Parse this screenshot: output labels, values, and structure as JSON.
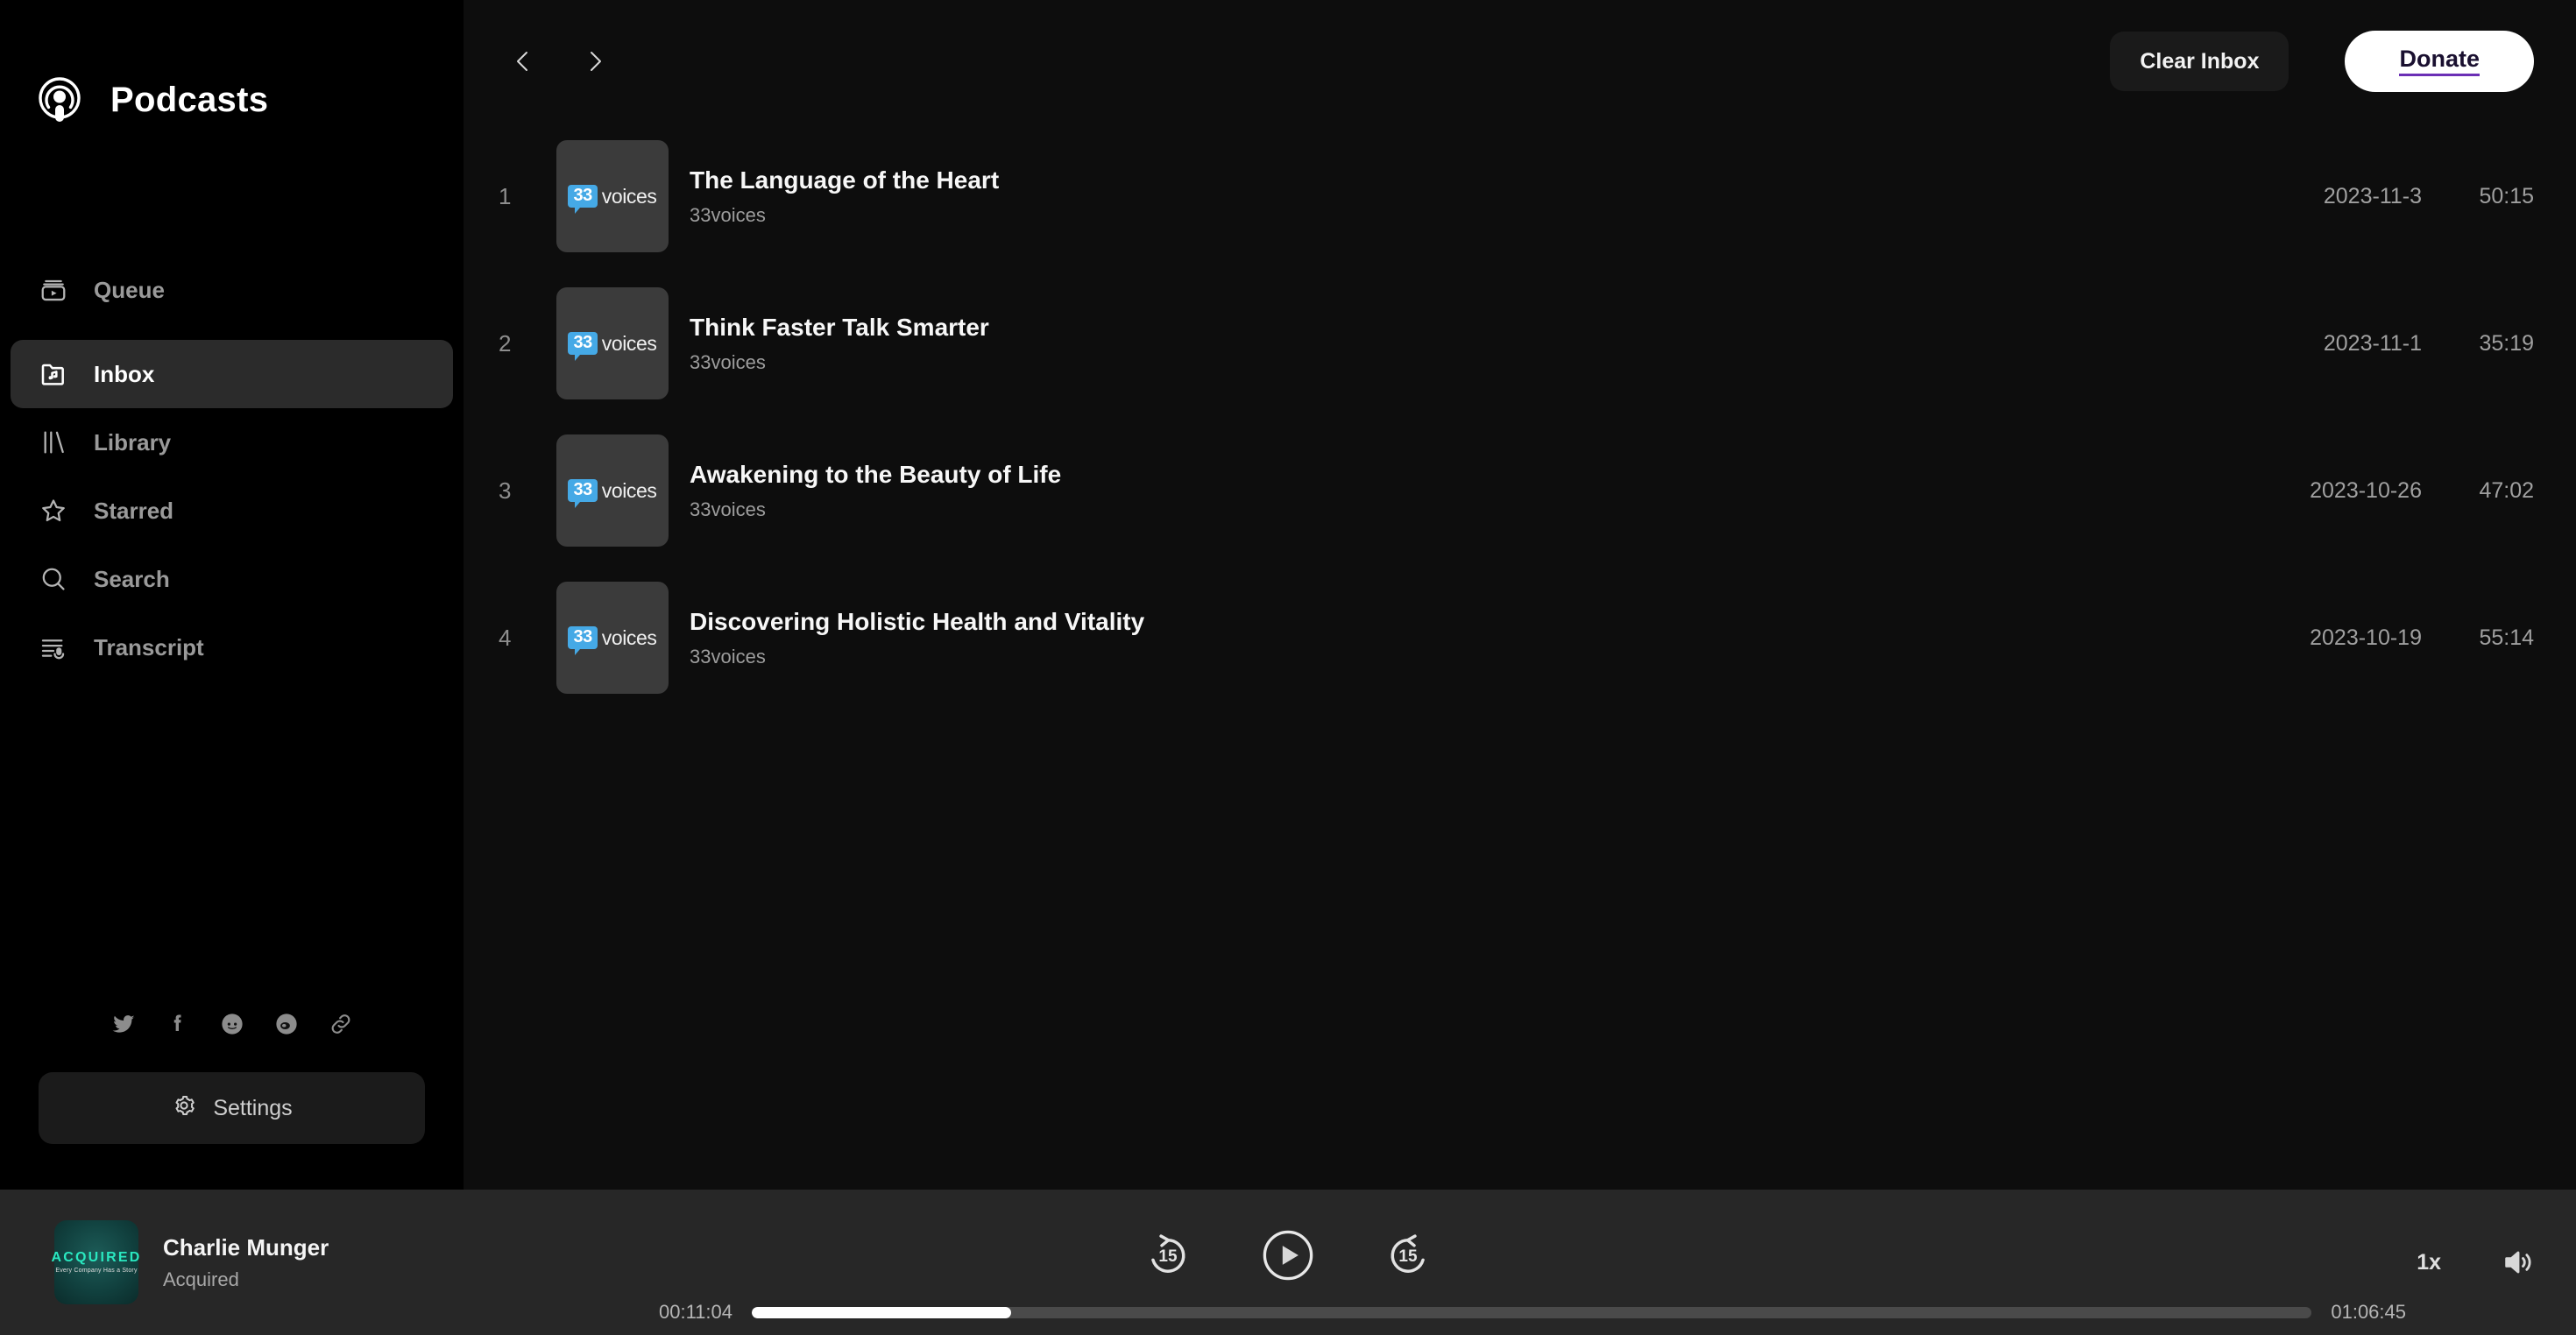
{
  "brand": {
    "title": "Podcasts",
    "logo_icon": "podcast-logo-icon"
  },
  "sidebar": {
    "items": [
      {
        "label": "Queue",
        "icon": "queue-icon",
        "active": false
      },
      {
        "label": "Inbox",
        "icon": "inbox-folder-icon",
        "active": true
      },
      {
        "label": "Library",
        "icon": "library-icon",
        "active": false
      },
      {
        "label": "Starred",
        "icon": "star-icon",
        "active": false
      },
      {
        "label": "Search",
        "icon": "search-icon",
        "active": false
      },
      {
        "label": "Transcript",
        "icon": "transcript-icon",
        "active": false
      }
    ],
    "socials": [
      {
        "name": "twitter-icon"
      },
      {
        "name": "facebook-icon"
      },
      {
        "name": "reddit-icon"
      },
      {
        "name": "weibo-icon"
      },
      {
        "name": "link-icon"
      }
    ],
    "settings_label": "Settings",
    "settings_icon": "gear-icon"
  },
  "topbar": {
    "back_icon": "chevron-left-icon",
    "forward_icon": "chevron-right-icon",
    "clear_inbox_label": "Clear Inbox",
    "donate_label": "Donate"
  },
  "episodes": [
    {
      "num": "1",
      "title": "The Language of the Heart",
      "show": "33voices",
      "date": "2023-11-3",
      "duration": "50:15",
      "art_badge": "33",
      "art_word": "voices"
    },
    {
      "num": "2",
      "title": "Think Faster Talk Smarter",
      "show": "33voices",
      "date": "2023-11-1",
      "duration": "35:19",
      "art_badge": "33",
      "art_word": "voices"
    },
    {
      "num": "3",
      "title": "Awakening to the Beauty of Life",
      "show": "33voices",
      "date": "2023-10-26",
      "duration": "47:02",
      "art_badge": "33",
      "art_word": "voices"
    },
    {
      "num": "4",
      "title": "Discovering Holistic Health and Vitality",
      "show": "33voices",
      "date": "2023-10-19",
      "duration": "55:14",
      "art_badge": "33",
      "art_word": "voices"
    }
  ],
  "player": {
    "episode_title": "Charlie Munger",
    "show_name": "Acquired",
    "artwork_title": "ACQUIRED",
    "artwork_tagline": "Every Company Has a Story",
    "rewind_seconds": "15",
    "forward_seconds": "15",
    "play_icon": "play-icon",
    "rewind_icon": "rewind-15-icon",
    "forward_icon": "forward-15-icon",
    "elapsed": "00:11:04",
    "total": "01:06:45",
    "progress_percent": 16.6,
    "speed_label": "1x",
    "volume_icon": "volume-icon"
  },
  "colors": {
    "sidebar_bg": "#000000",
    "main_bg": "#0d0d0d",
    "player_bg": "#272727",
    "active_nav_bg": "#2b2b2b",
    "accent_blue": "#45a9e6",
    "accent_teal": "#2ae8c0",
    "donate_underline": "#6b2fb5"
  }
}
